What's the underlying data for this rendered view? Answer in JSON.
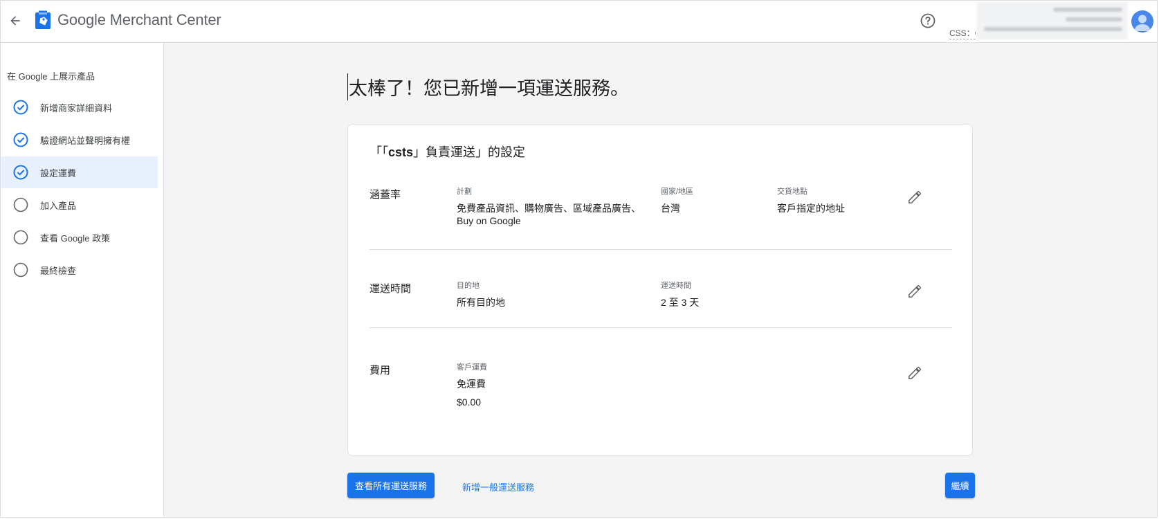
{
  "header": {
    "app_name_brand": "Google",
    "app_name_product": "Merchant Center",
    "css_label": "CSS：C"
  },
  "sidebar": {
    "heading": "在 Google 上展示產品",
    "steps": [
      {
        "label": "新增商家詳細資料",
        "done": true
      },
      {
        "label": "驗證網站並聲明擁有權",
        "done": true
      },
      {
        "label": "設定運費",
        "done": true
      },
      {
        "label": "加入產品",
        "done": false
      },
      {
        "label": "查看 Google 政策",
        "done": false
      },
      {
        "label": "最終檢查",
        "done": false
      }
    ]
  },
  "main": {
    "title": "太棒了！您已新增一項運送服務。",
    "card": {
      "title_prefix": "「「",
      "title_service": "csts",
      "title_suffix": "」負責運送」的設定",
      "coverage": {
        "heading": "涵蓋率",
        "plan_key": "計劃",
        "plan_value": "免費產品資訊、購物廣告、區域產品廣告、Buy on Google",
        "country_key": "國家/地區",
        "country_value": "台灣",
        "delivery_key": "交貨地點",
        "delivery_value": "客戶指定的地址"
      },
      "delivery_time": {
        "heading": "運送時間",
        "dest_key": "目的地",
        "dest_value": "所有目的地",
        "time_key": "運送時間",
        "time_value": "2 至 3 天"
      },
      "cost": {
        "heading": "費用",
        "key": "客戶運費",
        "value1": "免運費",
        "value2": "$0.00"
      }
    },
    "buttons": {
      "view_all": "查看所有運送服務",
      "add_general": "新增一般運送服務",
      "continue": "繼續"
    }
  },
  "colors": {
    "accent": "#1a73e8",
    "active_step_bg": "#e8f0fe",
    "main_bg": "#f4f4f4"
  },
  "icons": {
    "back": "arrow-back-icon",
    "logo": "merchant-center-logo",
    "help": "help-circle-icon",
    "avatar": "user-avatar",
    "step_done": "check-circle-icon",
    "step_todo": "empty-circle-icon",
    "edit": "pencil-icon"
  }
}
